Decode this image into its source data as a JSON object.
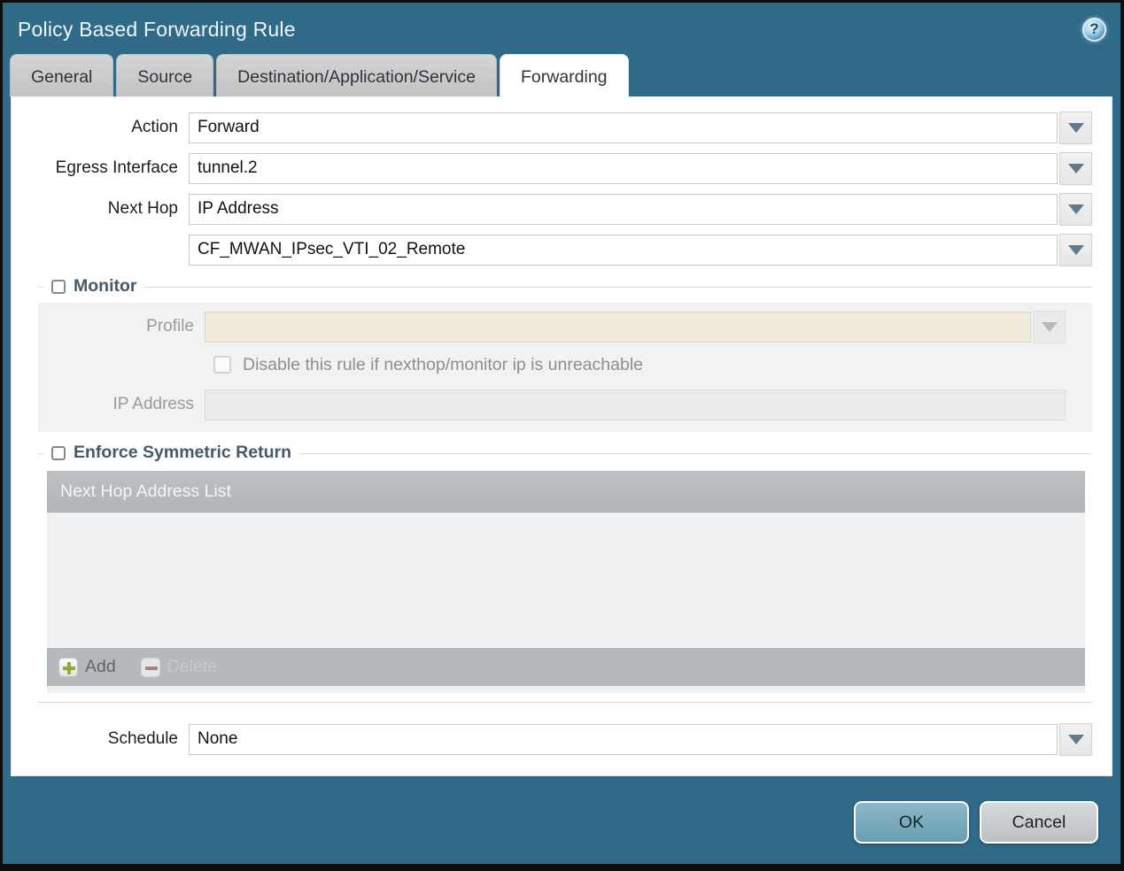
{
  "window": {
    "title": "Policy Based Forwarding Rule",
    "help_glyph": "?"
  },
  "tabs": [
    {
      "label": "General",
      "active": false
    },
    {
      "label": "Source",
      "active": false
    },
    {
      "label": "Destination/Application/Service",
      "active": false
    },
    {
      "label": "Forwarding",
      "active": true
    }
  ],
  "form": {
    "action": {
      "label": "Action",
      "value": "Forward"
    },
    "egress_interface": {
      "label": "Egress Interface",
      "value": "tunnel.2"
    },
    "next_hop": {
      "label": "Next Hop",
      "value": "IP Address"
    },
    "next_hop_address": {
      "value": "CF_MWAN_IPsec_VTI_02_Remote"
    },
    "schedule": {
      "label": "Schedule",
      "value": "None"
    }
  },
  "monitor": {
    "title": "Monitor",
    "checked": false,
    "profile": {
      "label": "Profile",
      "value": ""
    },
    "disable_rule_label": "Disable this rule if nexthop/monitor ip is unreachable",
    "ip_address": {
      "label": "IP Address",
      "value": ""
    }
  },
  "symmetric_return": {
    "title": "Enforce Symmetric Return",
    "checked": false,
    "table_header": "Next Hop Address List",
    "rows": [],
    "add_label": "Add",
    "delete_label": "Delete"
  },
  "footer": {
    "ok_label": "OK",
    "cancel_label": "Cancel"
  },
  "colors": {
    "titlebar_teal": "#2f6b89",
    "active_tab": "#ffffff",
    "disabled_input_beige": "#f1ecda",
    "table_header_gray": "#b5b9bc",
    "ok_button": "#72a9bc",
    "cancel_button": "#c7cbce"
  }
}
